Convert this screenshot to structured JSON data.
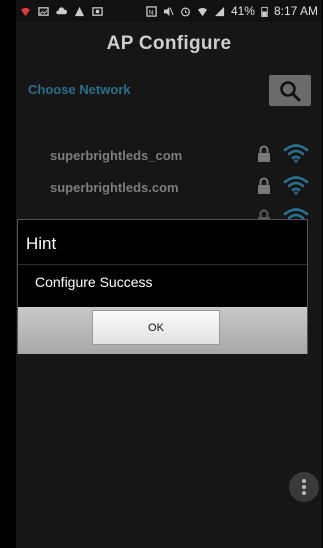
{
  "status_bar": {
    "battery": "41%",
    "time": "8:17 AM"
  },
  "app_bar": {
    "title": "AP Configure"
  },
  "header": {
    "choose_network_label": "Choose Network"
  },
  "networks": [
    {
      "name": "superbrightleds_com"
    },
    {
      "name": "superbrightleds.com"
    }
  ],
  "dialog": {
    "title": "Hint",
    "message": "Configure Success",
    "ok_label": "OK"
  },
  "colors": {
    "accent": "#2a6f8a",
    "wifi": "#2a6f8a"
  }
}
